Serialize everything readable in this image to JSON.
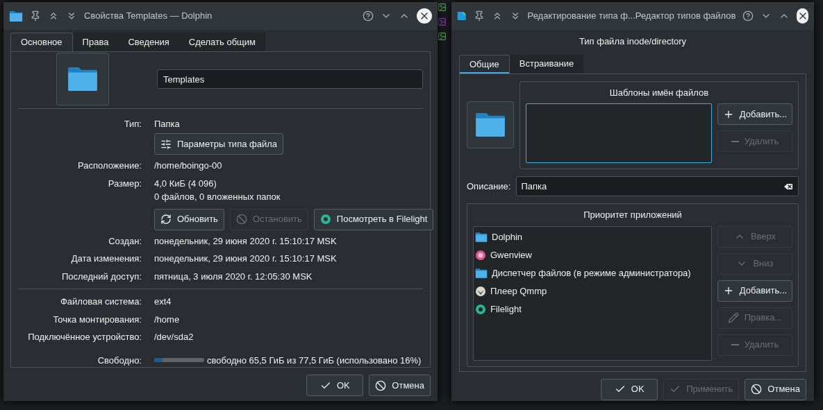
{
  "properties_window": {
    "title": "Свойства Templates — Dolphin",
    "tabs": [
      {
        "label": "Основное",
        "selected": true
      },
      {
        "label": "Права",
        "selected": false
      },
      {
        "label": "Сведения",
        "selected": false
      },
      {
        "label": "Сделать общим",
        "selected": false
      }
    ],
    "name": "Templates",
    "type": {
      "label": "Тип:",
      "value": "Папка",
      "button": "Параметры типа файла"
    },
    "location": {
      "label": "Расположение:",
      "value": "/home/boingo-00"
    },
    "size": {
      "label": "Размер:",
      "lines": [
        "4,0 КиБ (4 096)",
        "0 файлов, 0 вложенных папок"
      ]
    },
    "size_buttons": [
      {
        "label": "Обновить",
        "kind": "refresh",
        "disabled": false
      },
      {
        "label": "Остановить",
        "kind": "stop",
        "disabled": true
      },
      {
        "label": "Посмотреть в Filelight",
        "kind": "filelight",
        "disabled": false
      }
    ],
    "dates": [
      {
        "label": "Создан:",
        "value": "понедельник, 29 июня 2020 г. 15:10:17 MSK"
      },
      {
        "label": "Дата изменения:",
        "value": "понедельник, 29 июня 2020 г. 15:10:17 MSK"
      },
      {
        "label": "Последний доступ:",
        "value": "пятница, 3 июля 2020 г. 12:05:30 MSK"
      }
    ],
    "filesystem": [
      {
        "label": "Файловая система:",
        "value": "ext4"
      },
      {
        "label": "Точка монтирования:",
        "value": "/home"
      },
      {
        "label": "Подключённое устройство:",
        "value": "/dev/sda2"
      }
    ],
    "free": {
      "label": "Свободно:",
      "level": 0.16,
      "text": "свободно 65,5 ГиБ из 77,5 ГиБ (использовано 16%)"
    },
    "buttons": [
      {
        "label": "OK",
        "kind": "ok",
        "disabled": false
      },
      {
        "label": "Отмена",
        "kind": "cancel",
        "disabled": false
      }
    ]
  },
  "editor_window": {
    "title": "Редактирование типа ф...Редактор типов файлов",
    "heading": "Тип файла inode/directory",
    "tabs": [
      {
        "label": "Общие",
        "selected": true
      },
      {
        "label": "Встраивание",
        "selected": false
      }
    ],
    "patterns": {
      "title": "Шаблоны имён файлов",
      "buttons": [
        {
          "label": "Добавить...",
          "kind": "add",
          "disabled": false
        },
        {
          "label": "Удалить",
          "kind": "remove",
          "disabled": true
        }
      ]
    },
    "description": {
      "label": "Описание:",
      "value": "Папка"
    },
    "priority": {
      "title": "Приоритет приложений",
      "apps": [
        {
          "name": "Dolphin",
          "kind": "folder"
        },
        {
          "name": "Gwenview",
          "kind": "gwenview"
        },
        {
          "name": "Диспетчер файлов (в режиме администратора)",
          "kind": "folder"
        },
        {
          "name": "Плеер Qmmp",
          "kind": "qmmp"
        },
        {
          "name": "Filelight",
          "kind": "filelight"
        }
      ],
      "buttons": [
        {
          "label": "Вверх",
          "kind": "up",
          "disabled": true
        },
        {
          "label": "Вниз",
          "kind": "down",
          "disabled": true
        },
        {
          "label": "Добавить...",
          "kind": "add",
          "disabled": false
        },
        {
          "label": "Правка...",
          "kind": "edit",
          "disabled": true
        },
        {
          "label": "Удалить",
          "kind": "remove",
          "disabled": true
        }
      ]
    },
    "buttons": [
      {
        "label": "OK",
        "kind": "ok",
        "disabled": false
      },
      {
        "label": "Применить",
        "kind": "apply",
        "disabled": true
      },
      {
        "label": "Отмена",
        "kind": "cancel",
        "disabled": false
      }
    ]
  }
}
